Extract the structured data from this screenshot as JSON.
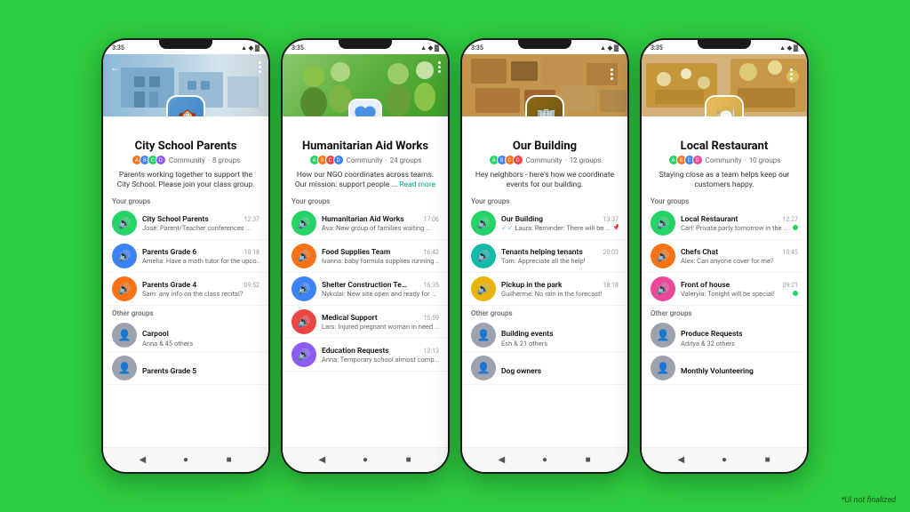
{
  "background_color": "#2ecc40",
  "disclaimer": "*UI not finalized",
  "phones": [
    {
      "id": "phone-1",
      "status_time": "3:35",
      "community_name": "City School Parents",
      "community_type": "Community",
      "community_groups_count": "8 groups",
      "community_description": "Parents working together to support the City School. Please join your class group.",
      "header_type": "school",
      "your_groups_label": "Your groups",
      "other_groups_label": "Other groups",
      "your_groups": [
        {
          "name": "City School Parents",
          "time": "12:37",
          "last_msg": "José: Parent/Teacher conferences ...",
          "has_unread": false,
          "color": "green"
        },
        {
          "name": "Parents Grade 6",
          "time": "10:18",
          "last_msg": "Amelia: Have a math tutor for the upco...",
          "has_unread": false,
          "color": "blue"
        },
        {
          "name": "Parents Grade 4",
          "time": "09:52",
          "last_msg": "Sam: any info on the class recital?",
          "has_unread": false,
          "color": "orange"
        }
      ],
      "other_groups": [
        {
          "name": "Carpool",
          "last_msg": "Anna & 45 others",
          "has_unread": false,
          "color": "gray"
        },
        {
          "name": "Parents Grade 5",
          "last_msg": "",
          "has_unread": false,
          "color": "gray"
        }
      ]
    },
    {
      "id": "phone-2",
      "status_time": "3:35",
      "community_name": "Humanitarian Aid Works",
      "community_type": "Community",
      "community_groups_count": "24 groups",
      "community_description": "How our NGO coordinates across teams. Our mission: support people ...",
      "read_more": "Read more",
      "header_type": "ngo",
      "your_groups_label": "Your groups",
      "your_groups": [
        {
          "name": "Humanitarian Aid Works",
          "time": "17:06",
          "last_msg": "Ava: New group of families waiting ...",
          "has_unread": false,
          "color": "green"
        },
        {
          "name": "Food Supplies Team",
          "time": "16:42",
          "last_msg": "Ivanna: baby formula supplies running ...",
          "has_unread": true,
          "color": "orange"
        },
        {
          "name": "Shelter Construction Team",
          "time": "16:35",
          "last_msg": "Nykolai: New site open and ready for ...",
          "has_unread": false,
          "color": "blue"
        },
        {
          "name": "Medical Support",
          "time": "15:59",
          "last_msg": "Lars: Injured pregnant woman in need ...",
          "has_unread": false,
          "color": "red"
        },
        {
          "name": "Education Requests",
          "time": "12:13",
          "last_msg": "Anna: Temporary school almost comp...",
          "has_unread": false,
          "color": "purple"
        }
      ],
      "other_groups": []
    },
    {
      "id": "phone-3",
      "status_time": "3:35",
      "community_name": "Our Building",
      "community_type": "Community",
      "community_groups_count": "12 groups",
      "community_description": "Hey neighbors - here's how we coordinate events for our building.",
      "header_type": "building",
      "your_groups_label": "Your groups",
      "other_groups_label": "Other groups",
      "your_groups": [
        {
          "name": "Our Building",
          "time": "13:37",
          "last_msg": "Laura: Reminder: There will be ...",
          "has_unread": false,
          "color": "green",
          "has_pin": true
        },
        {
          "name": "Tenants helping tenants",
          "time": "20:03",
          "last_msg": "Tom: Appreciate all the help!",
          "has_unread": false,
          "color": "teal"
        },
        {
          "name": "Pickup in the park",
          "time": "18:18",
          "last_msg": "Guilherme: No rain in the forecast!",
          "has_unread": false,
          "color": "yellow"
        }
      ],
      "other_groups": [
        {
          "name": "Building events",
          "last_msg": "Esh & 21 others",
          "has_unread": false,
          "color": "gray"
        },
        {
          "name": "Dog owners",
          "last_msg": "",
          "has_unread": false,
          "color": "gray"
        }
      ]
    },
    {
      "id": "phone-4",
      "status_time": "3:35",
      "community_name": "Local Restaurant",
      "community_type": "Community",
      "community_groups_count": "10 groups",
      "community_description": "Staying close as a team helps keep our customers happy.",
      "header_type": "restaurant",
      "your_groups_label": "Your groups",
      "other_groups_label": "Other groups",
      "your_groups": [
        {
          "name": "Local Restaurant",
          "time": "12:27",
          "last_msg": "Carl: Private party tomorrow in the ...",
          "has_unread": true,
          "color": "green"
        },
        {
          "name": "Chefs Chat",
          "time": "10:45",
          "last_msg": "Alex: Can anyone cover for me?",
          "has_unread": false,
          "color": "orange"
        },
        {
          "name": "Front of house",
          "time": "09:21",
          "last_msg": "Valeryia: Tonight will be special!",
          "has_unread": true,
          "color": "pink"
        }
      ],
      "other_groups": [
        {
          "name": "Produce Requests",
          "last_msg": "Aditya & 32 others",
          "has_unread": false,
          "color": "gray"
        },
        {
          "name": "Monthly Volunteering",
          "last_msg": "",
          "has_unread": false,
          "color": "gray"
        }
      ]
    }
  ]
}
